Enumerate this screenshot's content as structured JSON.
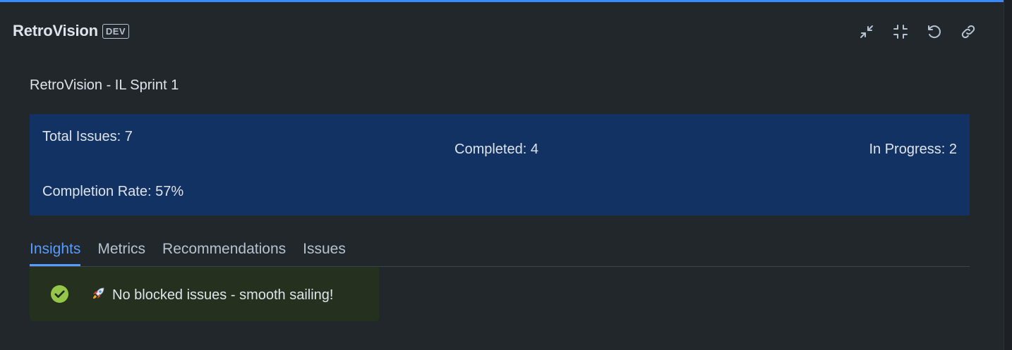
{
  "header": {
    "app_title": "RetroVision",
    "env_badge": "DEV",
    "actions": [
      {
        "name": "collapse",
        "icon": "minimize-arrows-icon"
      },
      {
        "name": "compress",
        "icon": "shrink-icon"
      },
      {
        "name": "refresh",
        "icon": "refresh-icon"
      },
      {
        "name": "link",
        "icon": "link-icon"
      }
    ]
  },
  "sprint": {
    "title": "RetroVision - IL Sprint 1"
  },
  "summary": {
    "total_issues": "Total Issues: 7",
    "completed": "Completed: 4",
    "in_progress": "In Progress: 2",
    "completion_rate": "Completion Rate: 57%"
  },
  "tabs": [
    {
      "label": "Insights",
      "active": true
    },
    {
      "label": "Metrics",
      "active": false
    },
    {
      "label": "Recommendations",
      "active": false
    },
    {
      "label": "Issues",
      "active": false
    }
  ],
  "insight": {
    "icon": "check-circle-icon",
    "emoji_icon": "rocket-icon",
    "text": "No blocked issues - smooth sailing!"
  },
  "colors": {
    "accent": "#579dff",
    "summary_bg": "#123263",
    "success": "#94c748",
    "success_bg": "#25301f"
  }
}
